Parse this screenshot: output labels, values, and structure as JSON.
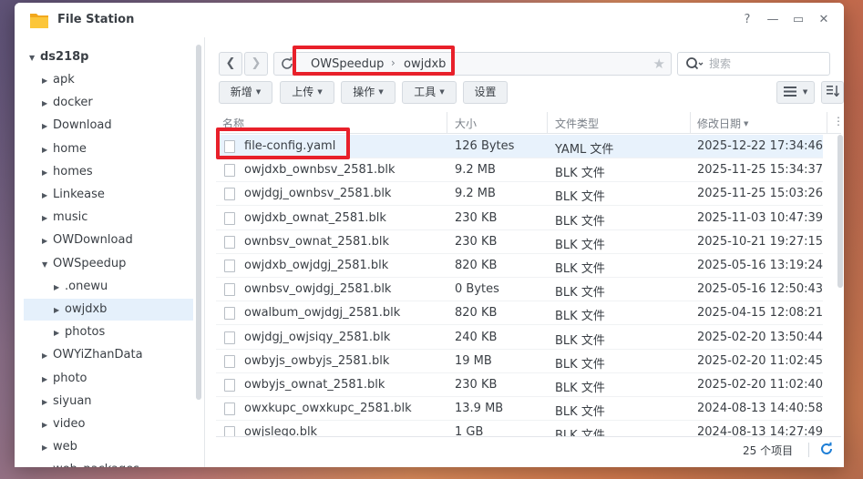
{
  "window": {
    "title": "File Station",
    "buttons": {
      "help": "?",
      "minimize": "—",
      "maximize": "▭",
      "close": "✕"
    }
  },
  "sidebar": {
    "root": "ds218p",
    "items": [
      {
        "label": "apk",
        "level": 1,
        "expanded": false
      },
      {
        "label": "docker",
        "level": 1,
        "expanded": false
      },
      {
        "label": "Download",
        "level": 1,
        "expanded": false
      },
      {
        "label": "home",
        "level": 1,
        "expanded": false
      },
      {
        "label": "homes",
        "level": 1,
        "expanded": false
      },
      {
        "label": "Linkease",
        "level": 1,
        "expanded": false
      },
      {
        "label": "music",
        "level": 1,
        "expanded": false
      },
      {
        "label": "OWDownload",
        "level": 1,
        "expanded": false
      },
      {
        "label": "OWSpeedup",
        "level": 1,
        "expanded": true
      },
      {
        "label": ".onewu",
        "level": 2,
        "expanded": false
      },
      {
        "label": "owjdxb",
        "level": 2,
        "expanded": false,
        "selected": true
      },
      {
        "label": "photos",
        "level": 2,
        "expanded": false
      },
      {
        "label": "OWYiZhanData",
        "level": 1,
        "expanded": false
      },
      {
        "label": "photo",
        "level": 1,
        "expanded": false
      },
      {
        "label": "siyuan",
        "level": 1,
        "expanded": false
      },
      {
        "label": "video",
        "level": 1,
        "expanded": false
      },
      {
        "label": "web",
        "level": 1,
        "expanded": false
      },
      {
        "label": "web_packages",
        "level": 1,
        "expanded": false
      }
    ]
  },
  "path": {
    "segments": [
      "OWSpeedup",
      "owjdxb"
    ],
    "separator": "›"
  },
  "search": {
    "placeholder": "搜索",
    "value": ""
  },
  "toolbar": {
    "create": "新增",
    "upload": "上传",
    "action": "操作",
    "tools": "工具",
    "settings": "设置"
  },
  "table": {
    "headers": {
      "name": "名称",
      "size": "大小",
      "type": "文件类型",
      "modified": "修改日期"
    },
    "rows": [
      {
        "name": "file-config.yaml",
        "size": "126 Bytes",
        "type": "YAML 文件",
        "modified": "2025-12-22 17:34:46",
        "selected": true
      },
      {
        "name": "owjdxb_ownbsv_2581.blk",
        "size": "9.2 MB",
        "type": "BLK 文件",
        "modified": "2025-11-25 15:34:37"
      },
      {
        "name": "owjdgj_ownbsv_2581.blk",
        "size": "9.2 MB",
        "type": "BLK 文件",
        "modified": "2025-11-25 15:03:26"
      },
      {
        "name": "owjdxb_ownat_2581.blk",
        "size": "230 KB",
        "type": "BLK 文件",
        "modified": "2025-11-03 10:47:39"
      },
      {
        "name": "ownbsv_ownat_2581.blk",
        "size": "230 KB",
        "type": "BLK 文件",
        "modified": "2025-10-21 19:27:15"
      },
      {
        "name": "owjdxb_owjdgj_2581.blk",
        "size": "820 KB",
        "type": "BLK 文件",
        "modified": "2025-05-16 13:19:24"
      },
      {
        "name": "ownbsv_owjdgj_2581.blk",
        "size": "0 Bytes",
        "type": "BLK 文件",
        "modified": "2025-05-16 12:50:43"
      },
      {
        "name": "owalbum_owjdgj_2581.blk",
        "size": "820 KB",
        "type": "BLK 文件",
        "modified": "2025-04-15 12:08:21"
      },
      {
        "name": "owjdgj_owjsiqy_2581.blk",
        "size": "240 KB",
        "type": "BLK 文件",
        "modified": "2025-02-20 13:50:44"
      },
      {
        "name": "owbyjs_owbyjs_2581.blk",
        "size": "19 MB",
        "type": "BLK 文件",
        "modified": "2025-02-20 11:02:45"
      },
      {
        "name": "owbyjs_ownat_2581.blk",
        "size": "230 KB",
        "type": "BLK 文件",
        "modified": "2025-02-20 11:02:40"
      },
      {
        "name": "owxkupc_owxkupc_2581.blk",
        "size": "13.9 MB",
        "type": "BLK 文件",
        "modified": "2024-08-13 14:40:58"
      },
      {
        "name": "owjslego.blk",
        "size": "1 GB",
        "type": "BLK 文件",
        "modified": "2024-08-13 14:27:49"
      }
    ]
  },
  "status": {
    "count": "25 个项目"
  },
  "colors": {
    "accent": "#1d7ed6",
    "highlight": "#e8202a",
    "selected_row": "#e8f2fc"
  }
}
